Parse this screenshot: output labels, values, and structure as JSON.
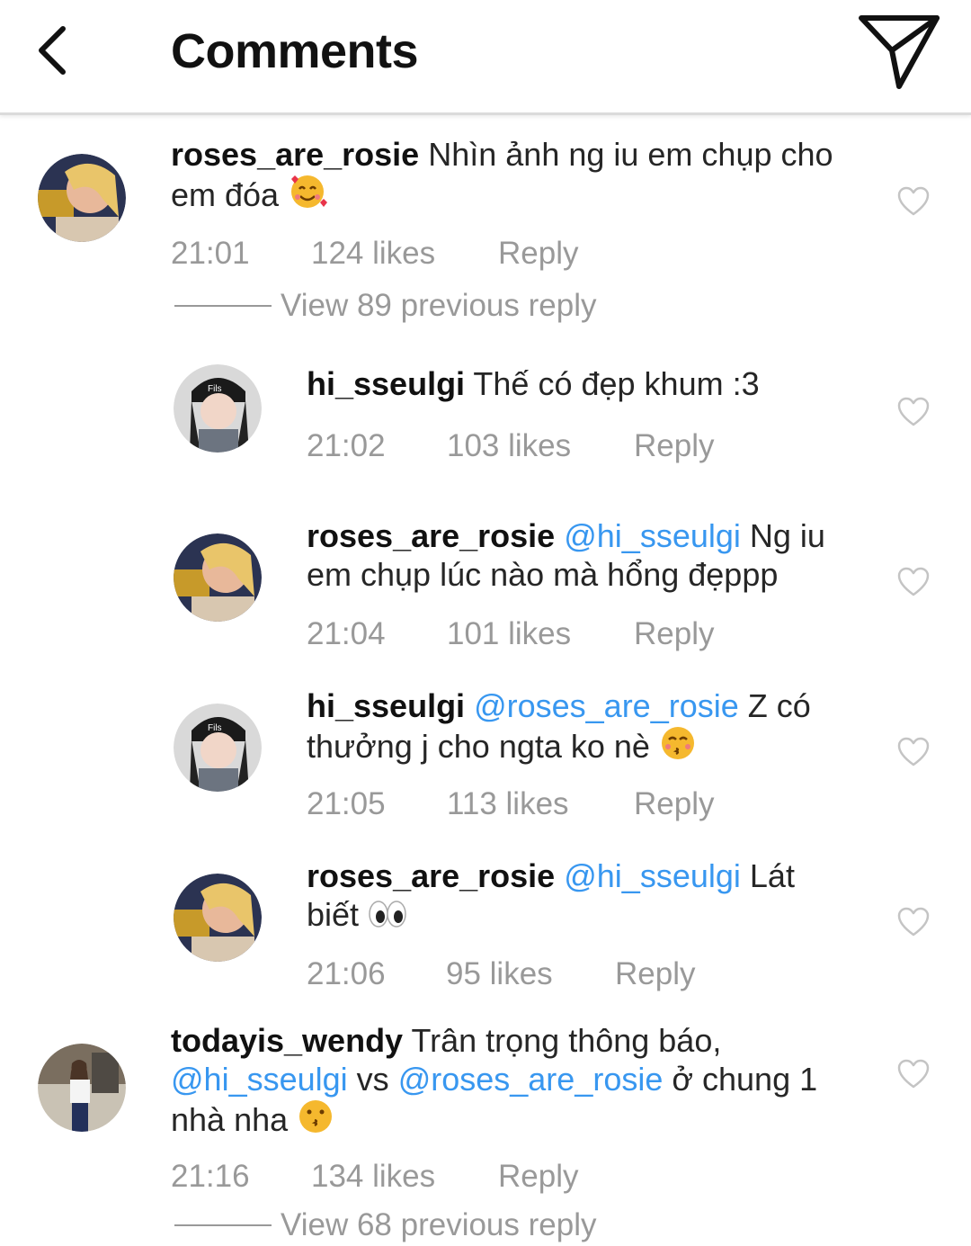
{
  "header": {
    "title": "Comments"
  },
  "comments": [
    {
      "username": "roses_are_rosie",
      "mention": "",
      "text": "Nhìn ảnh ng iu em chụp cho em đóa",
      "emoji": "smiling-face-with-hearts",
      "time": "21:01",
      "likes": "124 likes",
      "reply": "Reply",
      "view_replies": "View 89 previous reply"
    },
    {
      "username": "hi_sseulgi",
      "mention": "",
      "text": "Thế có đẹp khum :3",
      "time": "21:02",
      "likes": "103 likes",
      "reply": "Reply"
    },
    {
      "username": "roses_are_rosie",
      "mention": "@hi_sseulgi",
      "text_line1": "Ng iu",
      "text_line2": "em chụp lúc nào mà hổng đẹppp",
      "time": "21:04",
      "likes": "101 likes",
      "reply": "Reply"
    },
    {
      "username": "hi_sseulgi",
      "mention": "@roses_are_rosie",
      "text_line1": "Z có",
      "text_line2": "thưởng j cho ngta ko nè",
      "emoji": "kissing-face-with-smiling-eyes",
      "time": "21:05",
      "likes": "113 likes",
      "reply": "Reply"
    },
    {
      "username": "roses_are_rosie",
      "mention": "@hi_sseulgi",
      "text_line1": "Lát",
      "text_line2": "biết",
      "emoji": "eyes",
      "time": "21:06",
      "likes": "95 likes",
      "reply": "Reply"
    },
    {
      "username": "todayis_wendy",
      "mention": "@hi_sseulgi",
      "mention2": "@roses_are_rosie",
      "text_line1": "Trân trọng thông báo,",
      "text_mid": "vs",
      "text_after": "ở chung 1",
      "text_line3": "nhà nha",
      "emoji": "kissing-face",
      "time": "21:16",
      "likes": "134 likes",
      "reply": "Reply",
      "view_replies": "View 68 previous reply"
    }
  ],
  "colors": {
    "mention": "#3897f0",
    "meta": "#999999",
    "username": "#111111"
  },
  "icons": [
    "back-arrow-icon",
    "direct-send-icon",
    "heart-outline-icon"
  ]
}
